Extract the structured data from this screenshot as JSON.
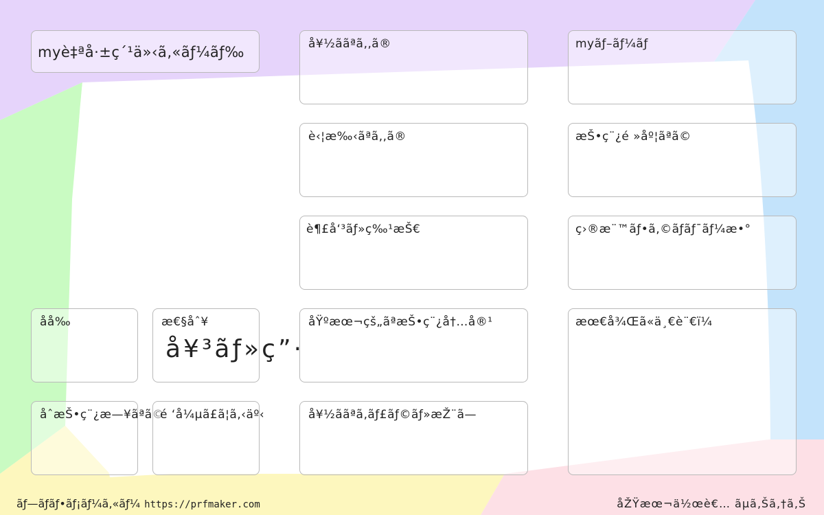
{
  "colors": {
    "lavender": "#e6d4fb",
    "mint": "#c9fbc2",
    "sky": "#c3e3fb",
    "lemon": "#fdf7be",
    "pink": "#fde0e6",
    "card_border": "#b9b9b9"
  },
  "card": {
    "title": "myè‡ªå·±ç´¹ä»‹ã‚«ãƒ¼ãƒ‰",
    "fields": {
      "likes": "å¥½ããªã‚‚ã®",
      "dislikes": "è‹¦æ‰‹ãªã‚‚ã®",
      "hobbies": "è¶£å‘³ãƒ»ç‰¹æŠ€",
      "basic_content": "åŸºæœ¬çš„ãªæŠ•ç¨¿å†…å®¹",
      "favorite_characters": "å¥½ããªã‚­ãƒ£ãƒ©ãƒ»æŽ¨ã—",
      "boom": "myãƒ–ãƒ¼ãƒ ",
      "post_frequency": "æŠ•ç¨¿é »åº¦ãªã©",
      "follower_goal": "ç›®æ¨™ãƒ•ã‚©ãƒ­ãƒ¯ãƒ¼æ•°",
      "last_word": "æœ€å¾Œã«ä¸€è¨€ï¼",
      "name": "åå‰",
      "gender": "æ€§åˆ¥",
      "gender_options": "å¥³ãƒ»ç”·",
      "first_post": "åˆæŠ•ç¨¿æ—¥ãªã©",
      "working_on": "é ‘å¼µã£ã¦ã‚‹äº‹"
    }
  },
  "footer": {
    "maker": "ãƒ—ãƒ­ãƒ•ãƒ¡ãƒ¼ã‚«ãƒ¼",
    "url": "https://prfmaker.com",
    "author": "åŽŸæœ¬ä½œè€… ãµã‚Šã‚†ã‚Š"
  }
}
